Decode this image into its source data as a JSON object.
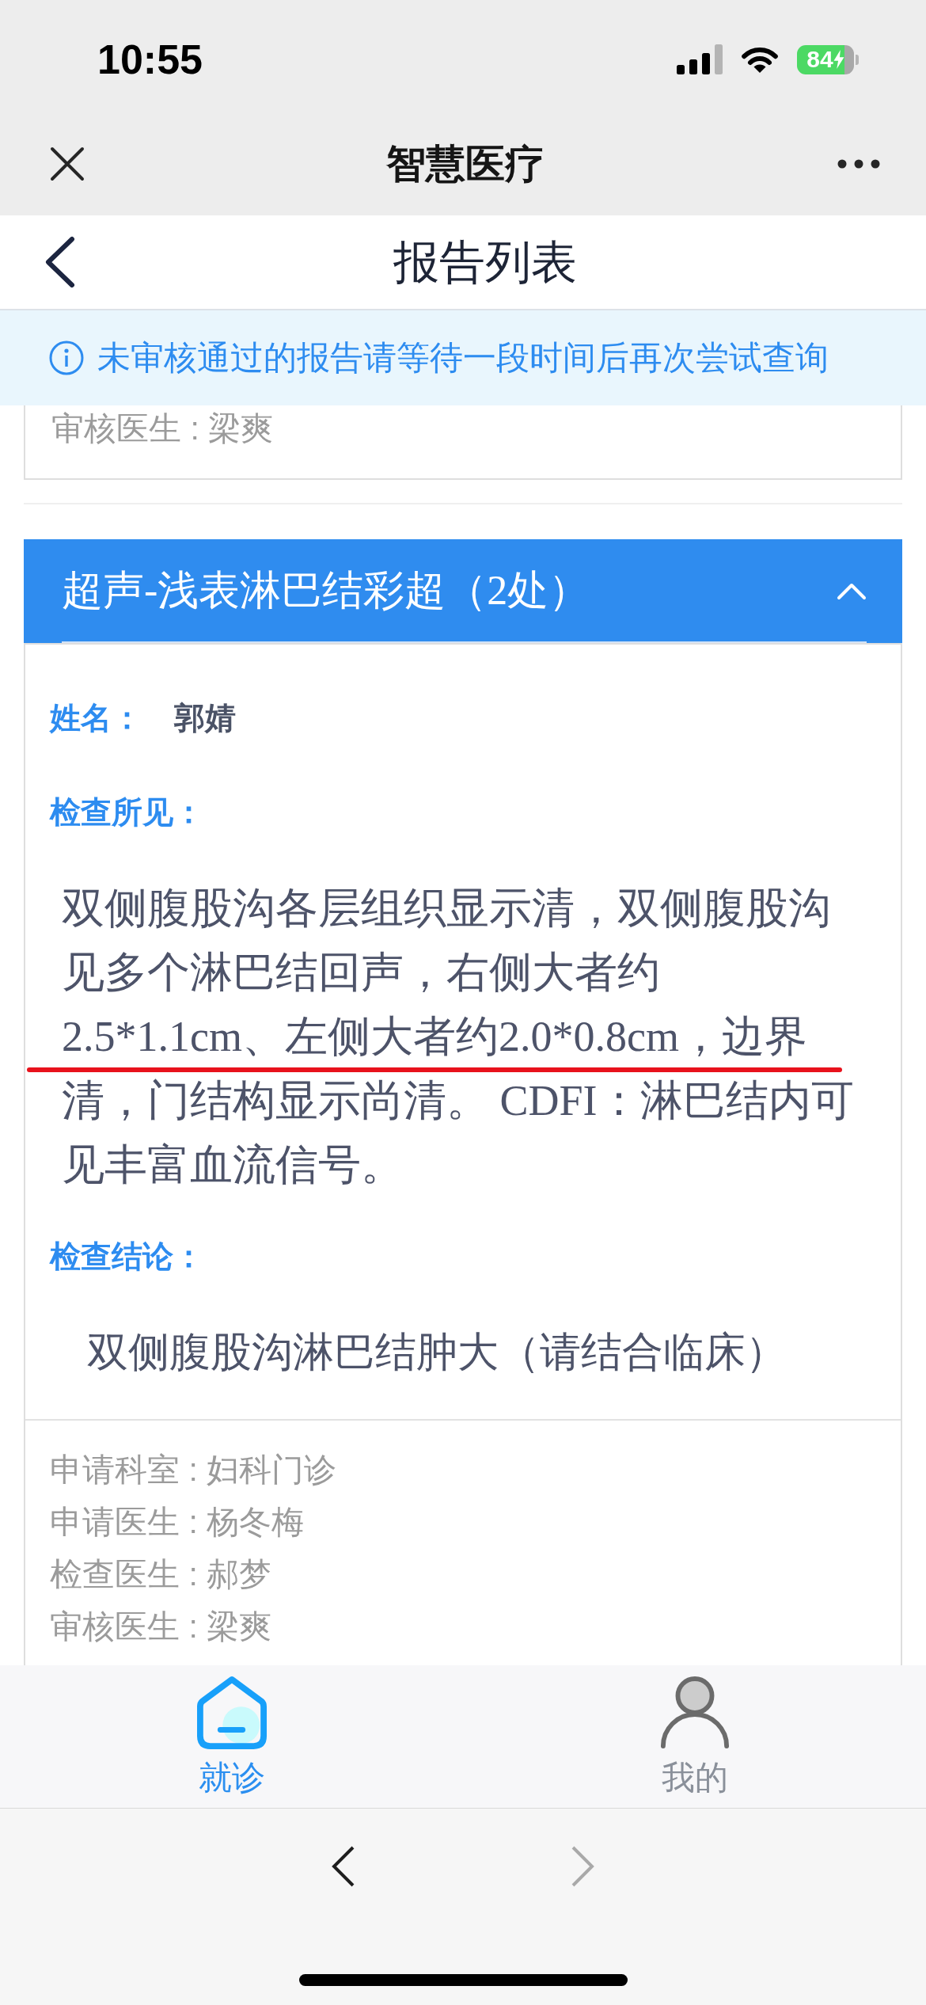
{
  "status_bar": {
    "time": "10:55",
    "battery": "84"
  },
  "mini_program_bar": {
    "title": "智慧医疗"
  },
  "page_header": {
    "title": "报告列表"
  },
  "notice": {
    "text": "未审核通过的报告请等待一段时间后再次尝试查询"
  },
  "previous_report": {
    "meta": [
      "审核医生 : 梁爽"
    ]
  },
  "report": {
    "title": "超声-浅表淋巴结彩超（2处）",
    "expanded": true,
    "name_label": "姓名：",
    "name": "郭婧",
    "findings_label": "检查所见：",
    "findings": "双侧腹股沟各层组织显示清，双侧腹股沟见多个淋巴结回声，右侧大者约2.5*1.1cm、左侧大者约2.0*0.8cm，边界清，门结构显示尚清。 CDFI：淋巴结内可见丰富血流信号。",
    "conclusion_label": "检查结论：",
    "conclusion": "双侧腹股沟淋巴结肿大（请结合临床）",
    "meta": [
      "申请科室 : 妇科门诊",
      "申请医生 : 杨冬梅",
      "检查医生 : 郝梦",
      "审核医生 : 梁爽"
    ]
  },
  "tab_bar": {
    "tabs": [
      {
        "kind": "home",
        "label": "就诊",
        "selected": true
      },
      {
        "kind": "profile",
        "label": "我的",
        "selected": false
      }
    ]
  },
  "browser_toolbar": {
    "buttons": [
      {
        "kind": "back",
        "disabled": false
      },
      {
        "kind": "forward",
        "disabled": true
      }
    ]
  }
}
